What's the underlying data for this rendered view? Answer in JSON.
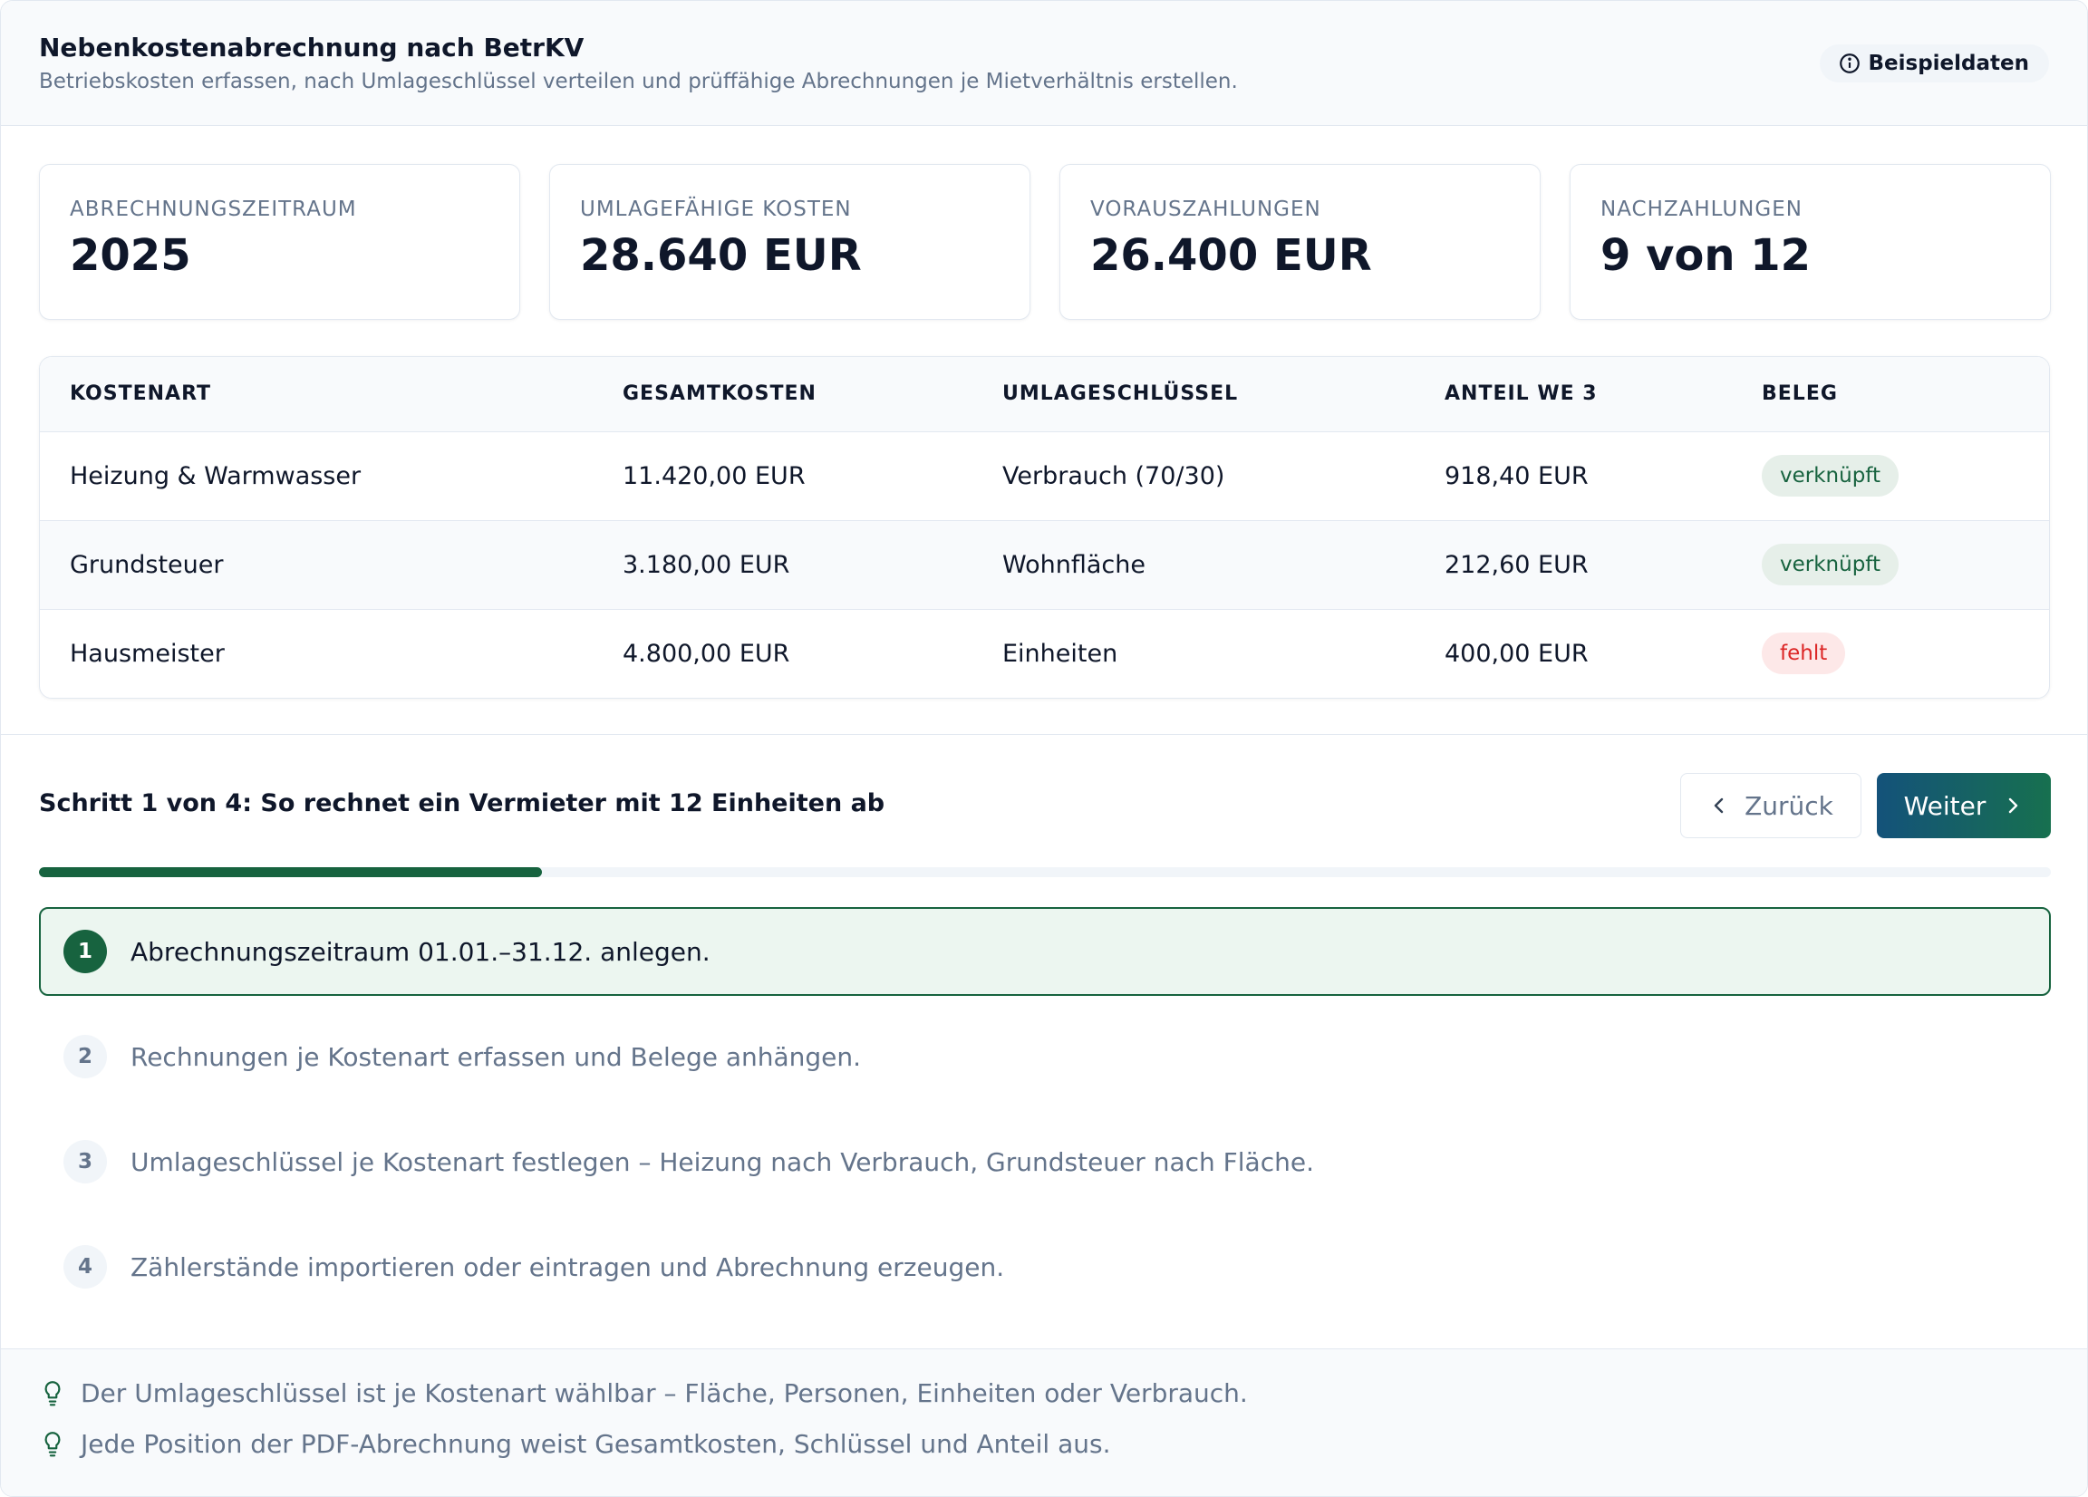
{
  "header": {
    "title": "Nebenkostenabrechnung nach BetrKV",
    "subtitle": "Betriebskosten erfassen, nach Umlageschlüssel verteilen und prüffähige Abrechnungen je Mietverhältnis erstellen.",
    "badge_label": "Beispieldaten",
    "badge_icon": "info-icon"
  },
  "kpis": [
    {
      "label": "ABRECHNUNGSZEITRAUM",
      "value": "2025"
    },
    {
      "label": "UMLAGEFÄHIGE KOSTEN",
      "value": "28.640 EUR"
    },
    {
      "label": "VORAUSZAHLUNGEN",
      "value": "26.400 EUR"
    },
    {
      "label": "NACHZAHLUNGEN",
      "value": "9 von 12"
    }
  ],
  "table": {
    "columns": [
      "KOSTENART",
      "GESAMTKOSTEN",
      "UMLAGESCHLÜSSEL",
      "ANTEIL WE 3",
      "BELEG"
    ],
    "rows": [
      {
        "kostenart": "Heizung & Warmwasser",
        "gesamt": "11.420,00 EUR",
        "schluessel": "Verbrauch (70/30)",
        "anteil": "918,40 EUR",
        "beleg": "verknüpft"
      },
      {
        "kostenart": "Grundsteuer",
        "gesamt": "3.180,00 EUR",
        "schluessel": "Wohnfläche",
        "anteil": "212,60 EUR",
        "beleg": "verknüpft"
      },
      {
        "kostenart": "Hausmeister",
        "gesamt": "4.800,00 EUR",
        "schluessel": "Einheiten",
        "anteil": "400,00 EUR",
        "beleg": "fehlt"
      }
    ]
  },
  "wizard": {
    "title": "Schritt 1 von 4: So rechnet ein Vermieter mit 12 Einheiten ab",
    "back_label": "Zurück",
    "next_label": "Weiter",
    "progress": 0.25,
    "steps": [
      {
        "num": "1",
        "text": "Abrechnungszeitraum 01.01.–31.12. anlegen."
      },
      {
        "num": "2",
        "text": "Rechnungen je Kostenart erfassen und Belege anhängen."
      },
      {
        "num": "3",
        "text": "Umlageschlüssel je Kostenart festlegen – Heizung nach Verbrauch, Grundsteuer nach Fläche."
      },
      {
        "num": "4",
        "text": "Zählerstände importieren oder eintragen und Abrechnung erzeugen."
      }
    ]
  },
  "tips": [
    "Der Umlageschlüssel ist je Kostenart wählbar – Fläche, Personen, Einheiten oder Verbrauch.",
    "Jede Position der PDF-Abrechnung weist Gesamtkosten, Schlüssel und Anteil aus."
  ],
  "colors": {
    "accent": "#17633f",
    "button_gradient_start": "#14527a",
    "status_ok": "#17633f",
    "status_missing": "#dc2626"
  }
}
